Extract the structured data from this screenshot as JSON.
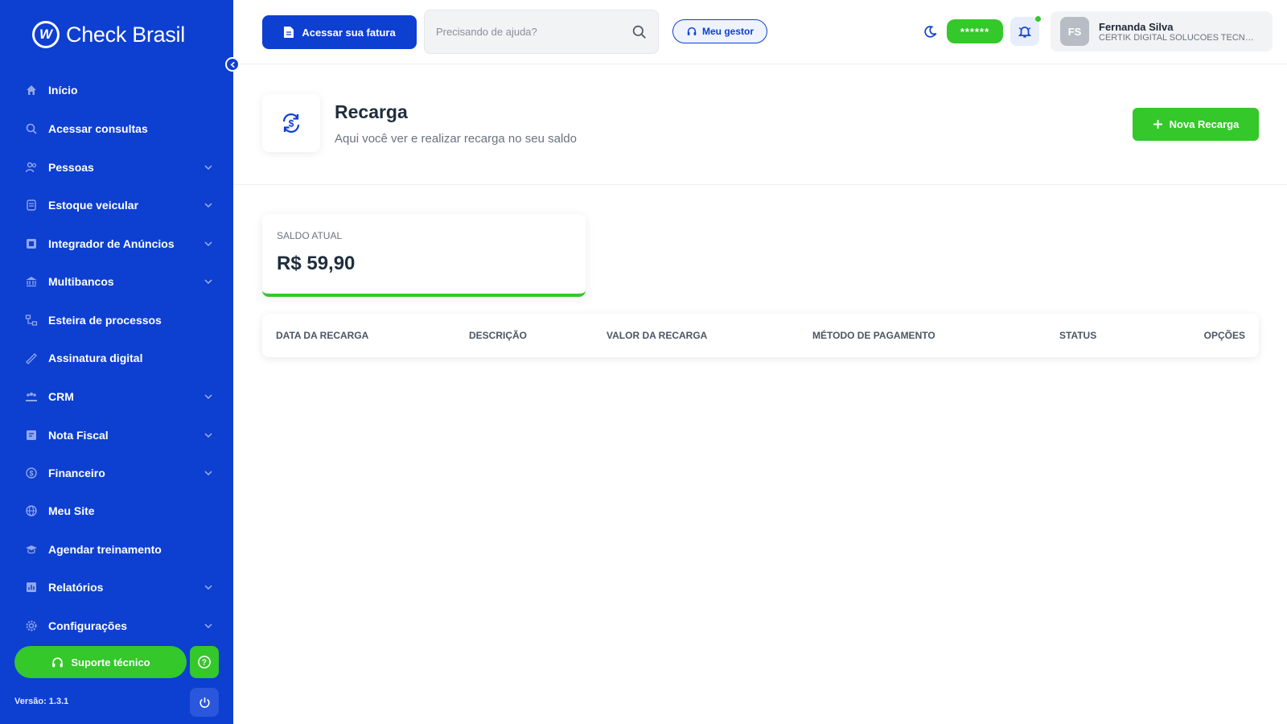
{
  "brand": {
    "logo_text": "Check Brasil",
    "logo_mark": "W"
  },
  "colors": {
    "primary": "#0d3fd1",
    "accent_green": "#34c82a",
    "background": "#ffffff"
  },
  "sidebar": {
    "items": [
      {
        "label": "Início",
        "icon": "home-icon",
        "has_chevron": false
      },
      {
        "label": "Acessar consultas",
        "icon": "search-icon",
        "has_chevron": false
      },
      {
        "label": "Pessoas",
        "icon": "people-icon",
        "has_chevron": true
      },
      {
        "label": "Estoque veicular",
        "icon": "vehicle-icon",
        "has_chevron": true
      },
      {
        "label": "Integrador de Anúncios",
        "icon": "ads-icon",
        "has_chevron": true
      },
      {
        "label": "Multibancos",
        "icon": "bank-icon",
        "has_chevron": true
      },
      {
        "label": "Esteira de processos",
        "icon": "process-icon",
        "has_chevron": false
      },
      {
        "label": "Assinatura digital",
        "icon": "signature-icon",
        "has_chevron": false
      },
      {
        "label": "CRM",
        "icon": "crm-icon",
        "has_chevron": true
      },
      {
        "label": "Nota Fiscal",
        "icon": "invoice-icon",
        "has_chevron": true
      },
      {
        "label": "Financeiro",
        "icon": "finance-icon",
        "has_chevron": true
      },
      {
        "label": "Meu Site",
        "icon": "globe-icon",
        "has_chevron": false
      },
      {
        "label": "Agendar treinamento",
        "icon": "graduation-icon",
        "has_chevron": false
      },
      {
        "label": "Relatórios",
        "icon": "report-icon",
        "has_chevron": true
      },
      {
        "label": "Configurações",
        "icon": "gear-icon",
        "has_chevron": true
      }
    ],
    "support_label": "Suporte técnico",
    "version": "Versão: 1.3.1"
  },
  "header": {
    "fatura_label": "Acessar sua fatura",
    "search_placeholder": "Precisando de ajuda?",
    "gestor_label": "Meu gestor",
    "balance_masked": "******",
    "user": {
      "initials": "FS",
      "name": "Fernanda Silva",
      "company": "CERTIK DIGITAL SOLUCOES TECNOLOGICAS"
    }
  },
  "page": {
    "title": "Recarga",
    "subtitle": "Aqui você ver e realizar recarga no seu saldo",
    "new_button": "Nova Recarga"
  },
  "balance": {
    "label": "SALDO ATUAL",
    "value": "R$ 59,90"
  },
  "table": {
    "columns": [
      "DATA DA RECARGA",
      "DESCRIÇÃO",
      "VALOR DA RECARGA",
      "MÉTODO DE PAGAMENTO",
      "STATUS",
      "OPÇÕES"
    ],
    "rows": []
  }
}
